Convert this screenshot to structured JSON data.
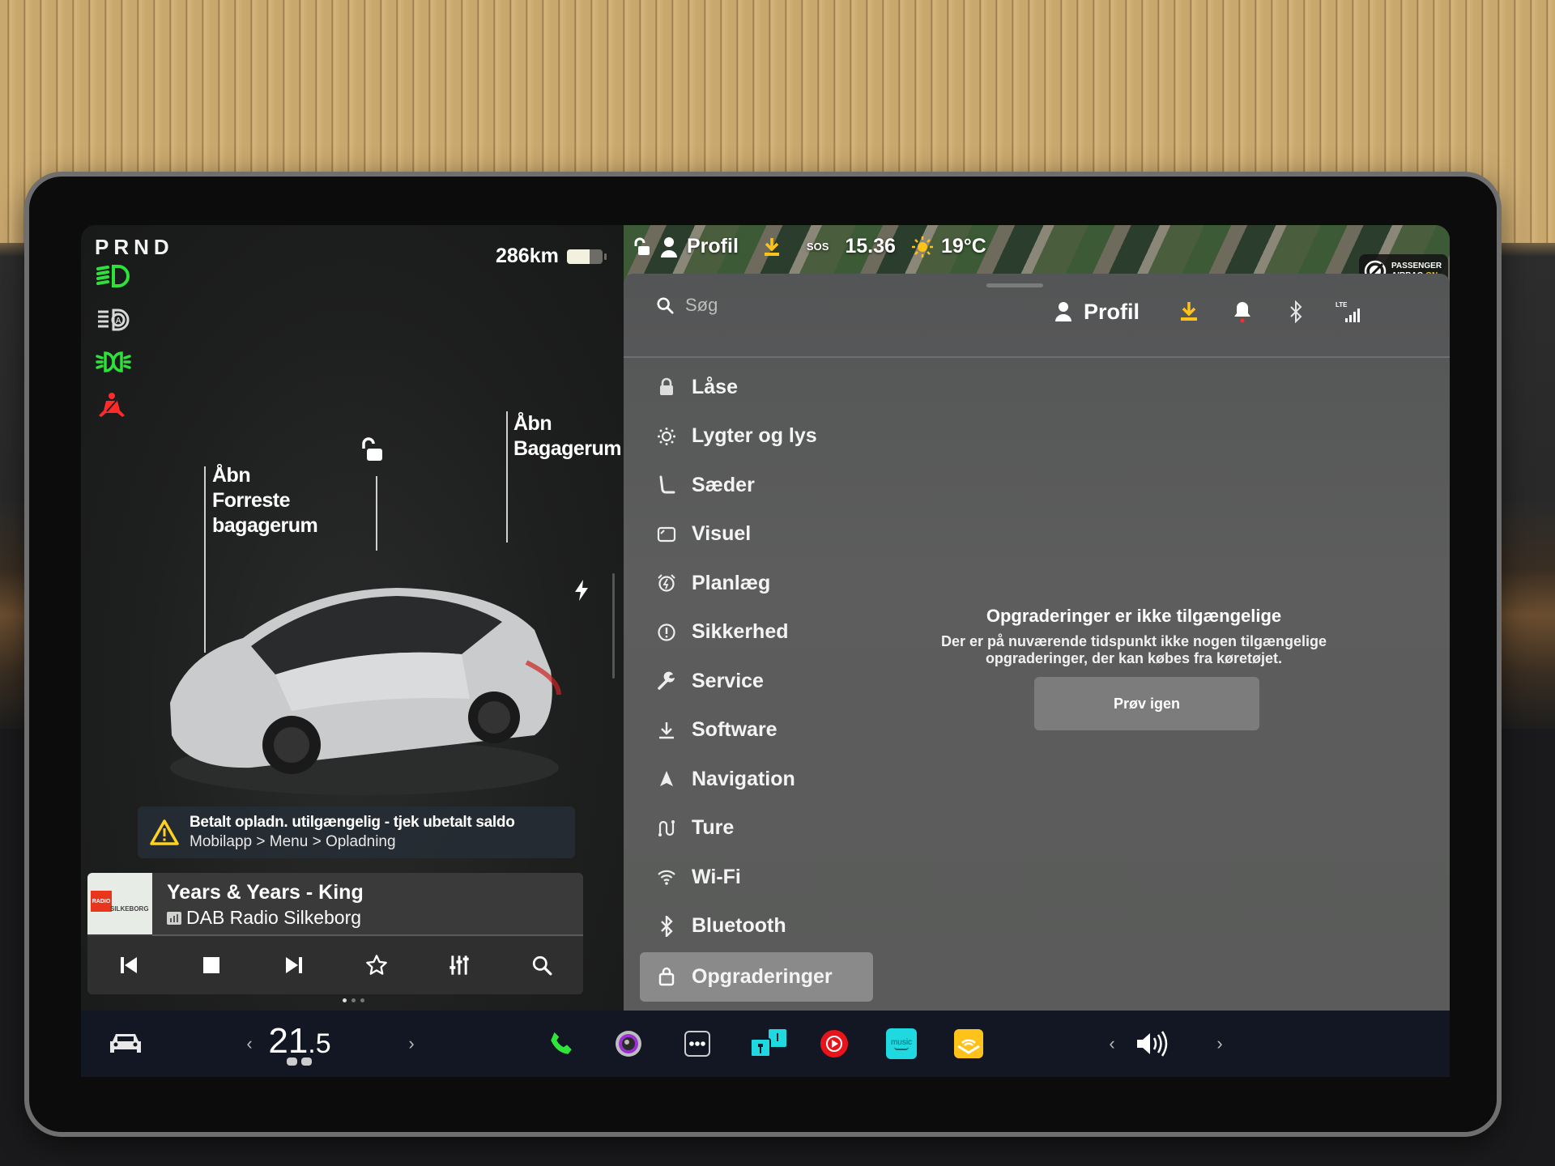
{
  "left_panel": {
    "gear": "PRND",
    "range": "286km",
    "battery_level": 0.65,
    "indicators": [
      {
        "icon": "low-beam-headlight-icon",
        "color": "#2fe03a"
      },
      {
        "icon": "auto-high-beam-icon",
        "color": "#d8d8d8"
      },
      {
        "icon": "parking-lights-icon",
        "color": "#2fe03a"
      },
      {
        "icon": "seatbelt-warning-icon",
        "color": "#ff2a2a"
      }
    ],
    "callouts": {
      "frunk_line1": "Åbn",
      "frunk_line2": "Forreste",
      "frunk_line3": "bagagerum",
      "trunk_line1": "Åbn",
      "trunk_line2": "Bagagerum"
    },
    "alert": {
      "title": "Betalt opladn. utilgængelig - tjek ubetalt saldo",
      "subtitle": "Mobilapp > Menu > Opladning"
    },
    "media": {
      "track": "Years & Years - King",
      "station": "DAB Radio Silkeborg",
      "album_art_line1": "RADIO",
      "album_art_line2": "SILKEBORG",
      "controls": [
        "previous",
        "stop",
        "next",
        "favorite",
        "equalizer",
        "search"
      ],
      "page_count": 3,
      "active_page": 1
    }
  },
  "status_bar": {
    "profile": "Profil",
    "sos": "SOS",
    "time": "15.36",
    "temperature": "19°C",
    "airbag_line1": "PASSENGER",
    "airbag_line2": "AIRBAG",
    "airbag_state": "ON"
  },
  "settings": {
    "search_placeholder": "Søg",
    "profile_label": "Profil",
    "menu": [
      {
        "label": "Låse",
        "icon": "lock-icon"
      },
      {
        "label": "Lygter og lys",
        "icon": "light-icon"
      },
      {
        "label": "Sæder",
        "icon": "seat-icon"
      },
      {
        "label": "Visuel",
        "icon": "display-icon"
      },
      {
        "label": "Planlæg",
        "icon": "alarm-clock-icon"
      },
      {
        "label": "Sikkerhed",
        "icon": "alert-circle-icon"
      },
      {
        "label": "Service",
        "icon": "wrench-icon"
      },
      {
        "label": "Software",
        "icon": "download-icon"
      },
      {
        "label": "Navigation",
        "icon": "navigation-arrow-icon"
      },
      {
        "label": "Ture",
        "icon": "trips-icon"
      },
      {
        "label": "Wi-Fi",
        "icon": "wifi-icon"
      },
      {
        "label": "Bluetooth",
        "icon": "bluetooth-icon"
      },
      {
        "label": "Opgraderinger",
        "icon": "shopping-bag-icon",
        "active": true
      }
    ],
    "content": {
      "title": "Opgraderinger er ikke tilgængelige",
      "body_line1": "Der er på nuværende tidspunkt ikke nogen tilgængelige",
      "body_line2": "opgraderinger, der kan købes fra køretøjet.",
      "retry_label": "Prøv igen"
    }
  },
  "bottom_bar": {
    "temp_whole": "21",
    "temp_decimal": ".5",
    "apps": [
      "phone",
      "camera",
      "more",
      "toybox",
      "youtube-music",
      "amazon-music",
      "audible"
    ],
    "amazon_music_label": "music"
  },
  "colors": {
    "green": "#2fe03a",
    "red": "#ff2a2a",
    "accent_yellow": "#ffc21a",
    "youtube_red": "#e8141c",
    "cyan": "#1fd8e0"
  }
}
